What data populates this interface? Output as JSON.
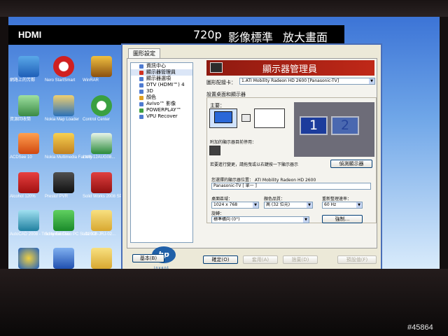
{
  "osd": {
    "input": "HDMI",
    "resolution": "720p",
    "mode": "影像標準",
    "zoom": "放大畫面"
  },
  "desktop_icons": [
    {
      "label": "網路上的芳鄰",
      "icon": "network-icon"
    },
    {
      "label": "Nero StartSmart",
      "icon": "nero-icon"
    },
    {
      "label": "WinRAR",
      "icon": "winrar-icon"
    },
    {
      "label": "資源回收筒",
      "icon": "recycle-bin-icon"
    },
    {
      "label": "Nokia Map Loader",
      "icon": "nokia-map-icon"
    },
    {
      "label": "Control Center",
      "icon": "control-center-icon"
    },
    {
      "label": "ACDSee 10",
      "icon": "acdsee-icon"
    },
    {
      "label": "Nokia Multimedia Factory",
      "icon": "nokia-multimedia-icon"
    },
    {
      "label": "1WB-12AUG08...",
      "icon": "excel-icon"
    },
    {
      "label": "Alcohol 120%",
      "icon": "alcohol-icon"
    },
    {
      "label": "Presto! PVR",
      "icon": "presto-icon"
    },
    {
      "label": "Solid Works 2008 SP0.0",
      "icon": "solidworks-icon"
    },
    {
      "label": "AutoCAD 2008 - Traditional Chi...",
      "icon": "autocad-icon"
    },
    {
      "label": "Sony Ericsson PC Suite 3.2",
      "icon": "sony-ericsson-icon"
    },
    {
      "label": "LC2008-JRJ-02...",
      "icon": "folder-icon"
    }
  ],
  "dialog": {
    "tab": "圖形設定",
    "tree": [
      {
        "label": "資訊中心"
      },
      {
        "label": "顯示器管理員"
      },
      {
        "label": "顯示器選項"
      },
      {
        "label": "DTV (HDMI™) 4"
      },
      {
        "label": "3D"
      },
      {
        "label": "顏色"
      },
      {
        "label": "Avivo™ 影像"
      },
      {
        "label": "POWERPLAY™"
      },
      {
        "label": "VPU Recover"
      }
    ],
    "logo_text": "hp",
    "logo_sub": "invent",
    "banner_title": "顯示器管理員",
    "adapter_label": "圖形配接卡：",
    "adapter_value": "1.ATI Mobility Radeon HD 2600 [Panasonic-TV]",
    "setup_label": "設置桌面和顯示器",
    "primary_label": "主要：",
    "attached_label": "附加的顯示器目前停用：",
    "hint": "若要進行變更，請拖曳或以右鍵按一下顯示器示",
    "detect_button": "偵測顯示器",
    "monitor_1": "1",
    "monitor_2": "2",
    "selected_label": "您選擇的顯示器位置： ATI Mobility Radeon HD 2600",
    "selected_value": "Panasonic-TV [ 單一 ]",
    "desktop_area_label": "桌面區域：",
    "desktop_area_value": "1024 x 768",
    "color_quality_label": "顏色品質：",
    "color_quality_value": "高 (32 位元)",
    "refresh_label": "重新整理速率：",
    "refresh_value": "60 Hz",
    "rotation_label": "旋轉：",
    "rotation_value": "標準橫向 (0°)",
    "force_button": "強制...",
    "basic_button": "基本(B)",
    "ok_button": "確定(O)",
    "apply_button": "套用(A)",
    "discard_button": "捨棄(D)",
    "defaults_button": "預設值(F)"
  },
  "watermark": "#45864"
}
